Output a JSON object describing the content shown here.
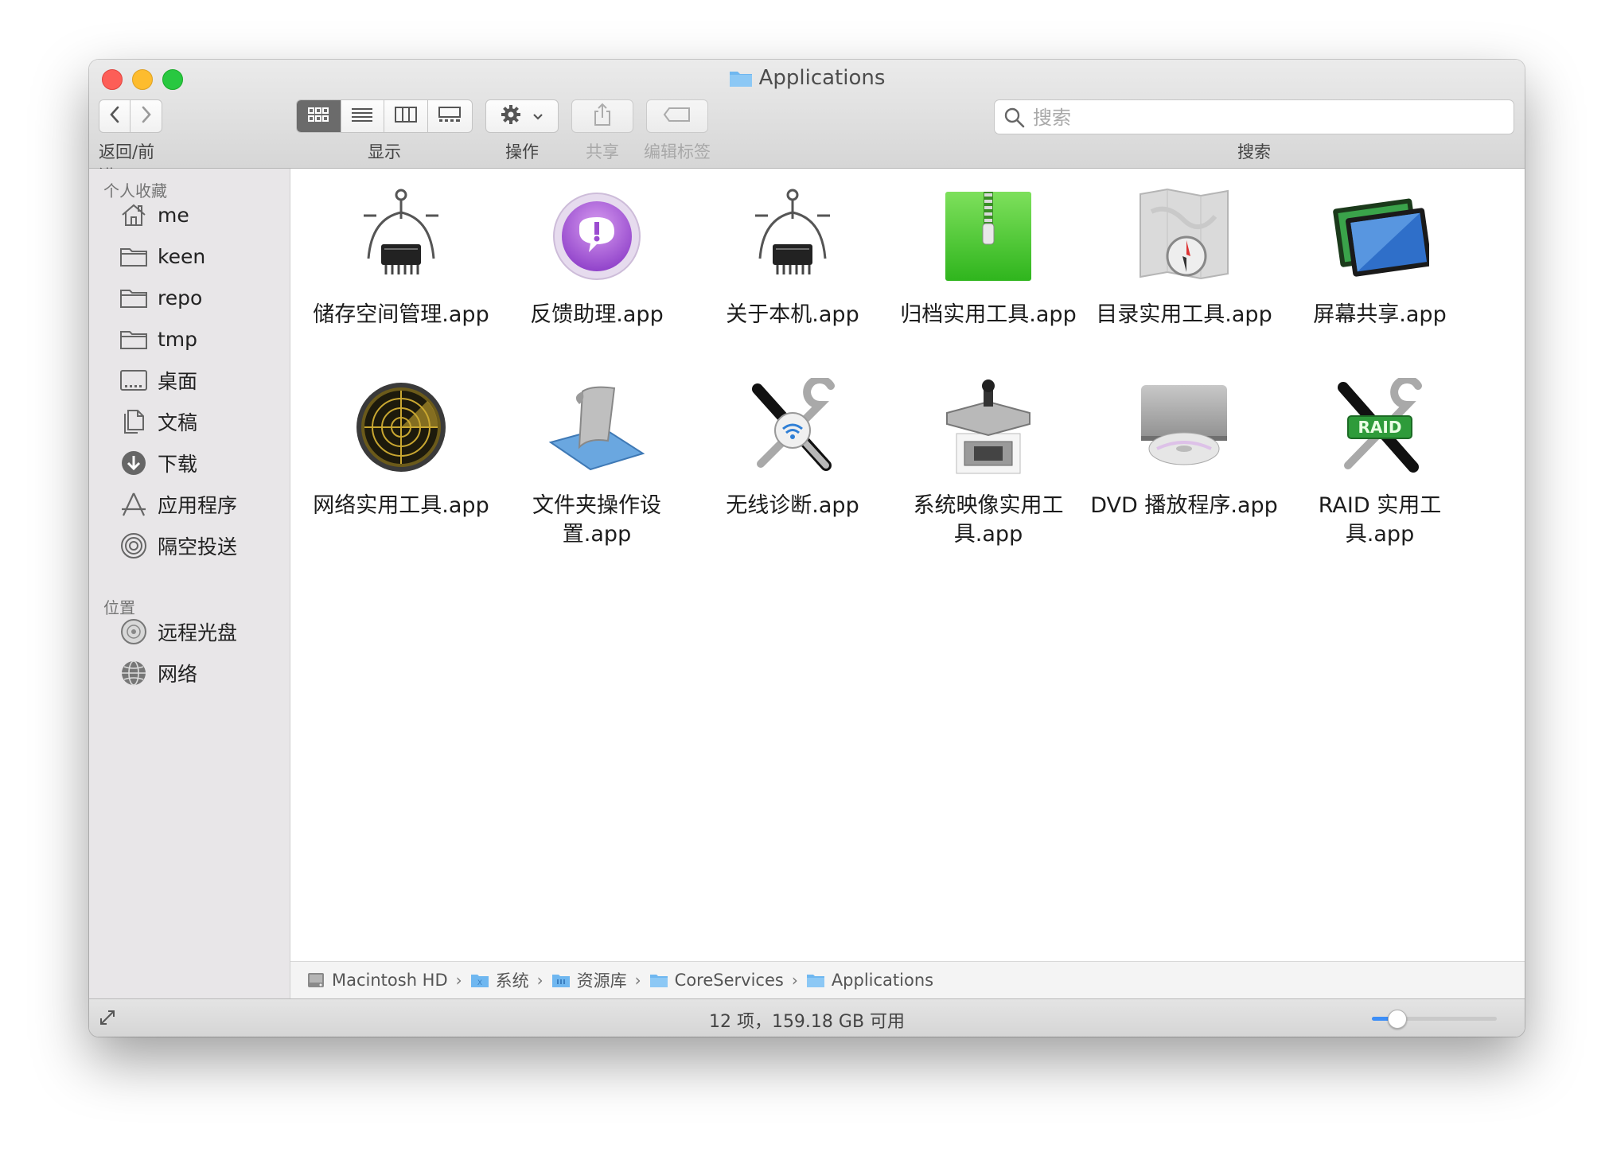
{
  "window": {
    "title": "Applications"
  },
  "toolbar": {
    "back_forward_label": "返回/前进",
    "view_label": "显示",
    "action_label": "操作",
    "share_label": "共享",
    "tags_label": "编辑标签",
    "search_label": "搜索",
    "search_placeholder": "搜索",
    "view_modes": [
      "icon-view",
      "list-view",
      "column-view",
      "gallery-view"
    ],
    "active_view": "icon-view"
  },
  "sidebar": {
    "favorites_heading": "个人收藏",
    "favorites": [
      {
        "label": "me",
        "icon": "home-icon"
      },
      {
        "label": "keen",
        "icon": "folder-icon"
      },
      {
        "label": "repo",
        "icon": "folder-icon"
      },
      {
        "label": "tmp",
        "icon": "folder-icon"
      },
      {
        "label": "桌面",
        "icon": "desktop-icon"
      },
      {
        "label": "文稿",
        "icon": "documents-icon"
      },
      {
        "label": "下载",
        "icon": "download-icon"
      },
      {
        "label": "应用程序",
        "icon": "applications-icon"
      },
      {
        "label": "隔空投送",
        "icon": "airdrop-icon"
      }
    ],
    "locations_heading": "位置",
    "locations": [
      {
        "label": "远程光盘",
        "icon": "remote-disc-icon"
      },
      {
        "label": "网络",
        "icon": "network-icon"
      }
    ]
  },
  "files": [
    {
      "label": "储存空间管理.app",
      "icon": "calipers-icon"
    },
    {
      "label": "反馈助理.app",
      "icon": "feedback-icon"
    },
    {
      "label": "关于本机.app",
      "icon": "calipers-icon"
    },
    {
      "label": "归档实用工具.app",
      "icon": "zip-archive-icon"
    },
    {
      "label": "目录实用工具.app",
      "icon": "directory-map-icon"
    },
    {
      "label": "屏幕共享.app",
      "icon": "screen-sharing-icon"
    },
    {
      "label": "网络实用工具.app",
      "icon": "radar-icon"
    },
    {
      "label": "文件夹操作设置.app",
      "icon": "script-icon"
    },
    {
      "label": "无线诊断.app",
      "icon": "wireless-diagnostics-icon"
    },
    {
      "label": "系统映像实用工具.app",
      "icon": "system-image-icon"
    },
    {
      "label": "DVD 播放程序.app",
      "icon": "dvd-player-icon"
    },
    {
      "label": "RAID 实用工具.app",
      "icon": "raid-utility-icon"
    }
  ],
  "pathbar": [
    {
      "label": "Macintosh HD",
      "icon": "hard-drive-icon"
    },
    {
      "label": "系统",
      "icon": "system-folder-icon"
    },
    {
      "label": "资源库",
      "icon": "library-folder-icon"
    },
    {
      "label": "CoreServices",
      "icon": "folder-icon"
    },
    {
      "label": "Applications",
      "icon": "folder-icon"
    }
  ],
  "status": {
    "text": "12 项，159.18 GB 可用",
    "icon_size_fraction": 0.2
  },
  "colors": {
    "accent": "#3d8ef7",
    "folder": "#6fb7f0",
    "sidebar_bg": "#e8e6e8",
    "close": "#fd5e57",
    "minimize": "#fdbc2e",
    "zoom": "#28c840"
  }
}
